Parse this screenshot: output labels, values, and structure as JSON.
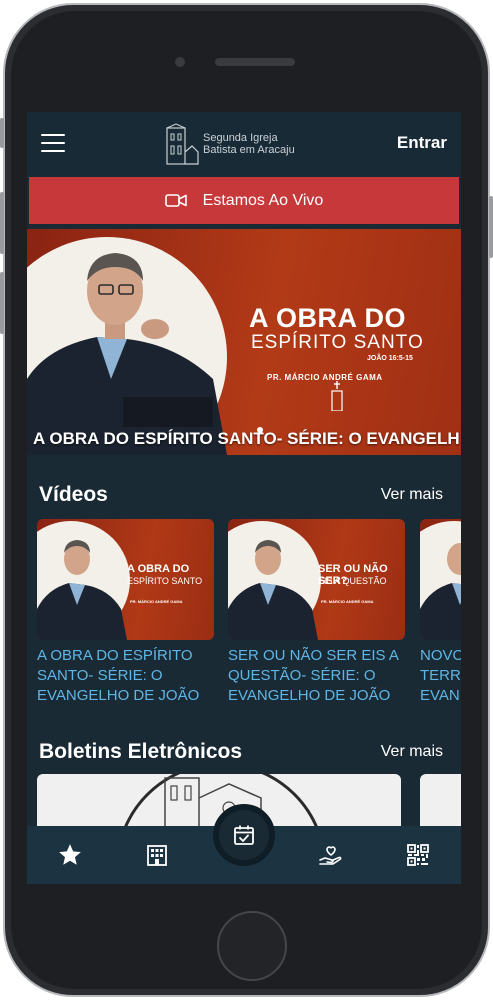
{
  "header": {
    "logo_line1": "Segunda Igreja",
    "logo_line2": "Batista em Aracaju",
    "login_label": "Entrar"
  },
  "live": {
    "label": "Estamos Ao Vivo",
    "icon": "video-camera-icon"
  },
  "hero": {
    "banner_title_1": "A OBRA DO",
    "banner_title_2": "ESPÍRITO SANTO",
    "banner_ref": "JOÃO 16:5-15",
    "banner_pastor": "PR. MÁRCIO ANDRÉ GAMA",
    "caption": "A OBRA DO ESPÍRITO SANTO- SÉRIE: O EVANGELH"
  },
  "videos": {
    "title": "Vídeos",
    "more_label": "Ver mais",
    "items": [
      {
        "thumb_t1": "A OBRA DO",
        "thumb_t2": "ESPÍRITO SANTO",
        "thumb_pastor": "PR. MÁRCIO ANDRÉ GAMA",
        "title_l1": "A OBRA DO ESPÍRITO",
        "title_l2": "SANTO- SÉRIE: O",
        "title_l3": "EVANGELHO DE JOÃO"
      },
      {
        "thumb_t1": "SER OU NÃO SER?",
        "thumb_t2": "EIS A QUESTÃO",
        "thumb_pastor": "PR. MÁRCIO ANDRÉ GAMA",
        "title_l1": "SER OU NÃO SER EIS A",
        "title_l2": "QUESTÃO- SÉRIE: O",
        "title_l3": "EVANGELHO DE JOÃO"
      },
      {
        "thumb_t1": "",
        "thumb_t2": "",
        "thumb_pastor": "",
        "title_l1": "NOVO",
        "title_l2": "TERRA",
        "title_l3": "EVAN"
      }
    ]
  },
  "boletins": {
    "title": "Boletins Eletrônicos",
    "more_label": "Ver mais"
  },
  "tabbar": {
    "items": [
      "star-icon",
      "building-icon",
      "calendar-check-icon",
      "hand-heart-icon",
      "qr-code-icon"
    ]
  },
  "colors": {
    "header_bg": "#182a36",
    "screen_bg": "#1a2a35",
    "live_red": "#c7383a",
    "link_blue": "#5fb6e6",
    "tabbar_bg": "#1c3342"
  }
}
